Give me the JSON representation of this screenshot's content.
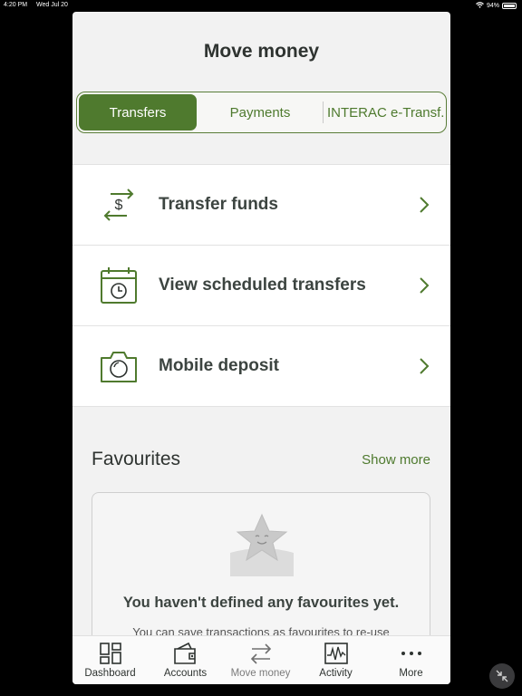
{
  "status": {
    "time": "4:20 PM",
    "date": "Wed Jul 20",
    "battery": "94%"
  },
  "header": {
    "title": "Move money"
  },
  "tabs": [
    {
      "label": "Transfers",
      "active": true
    },
    {
      "label": "Payments",
      "active": false
    },
    {
      "label": "INTERAC e-Transf...",
      "active": false
    }
  ],
  "actions": [
    {
      "label": "Transfer funds",
      "icon": "transfer-dollar-icon"
    },
    {
      "label": "View scheduled transfers",
      "icon": "calendar-clock-icon"
    },
    {
      "label": "Mobile deposit",
      "icon": "camera-icon"
    }
  ],
  "favourites": {
    "title": "Favourites",
    "show_more": "Show more",
    "empty_title": "You haven't defined any favourites yet.",
    "empty_sub": "You can save transactions as favourites to re-use"
  },
  "nav": [
    {
      "label": "Dashboard",
      "icon": "dashboard-icon"
    },
    {
      "label": "Accounts",
      "icon": "wallet-icon"
    },
    {
      "label": "Move money",
      "icon": "transfer-arrows-icon",
      "active": true
    },
    {
      "label": "Activity",
      "icon": "activity-icon"
    },
    {
      "label": "More",
      "icon": "more-dots-icon"
    }
  ],
  "colors": {
    "brand_green": "#4f7a2e",
    "text_dark": "#2e3330",
    "background": "#f2f2f2"
  }
}
